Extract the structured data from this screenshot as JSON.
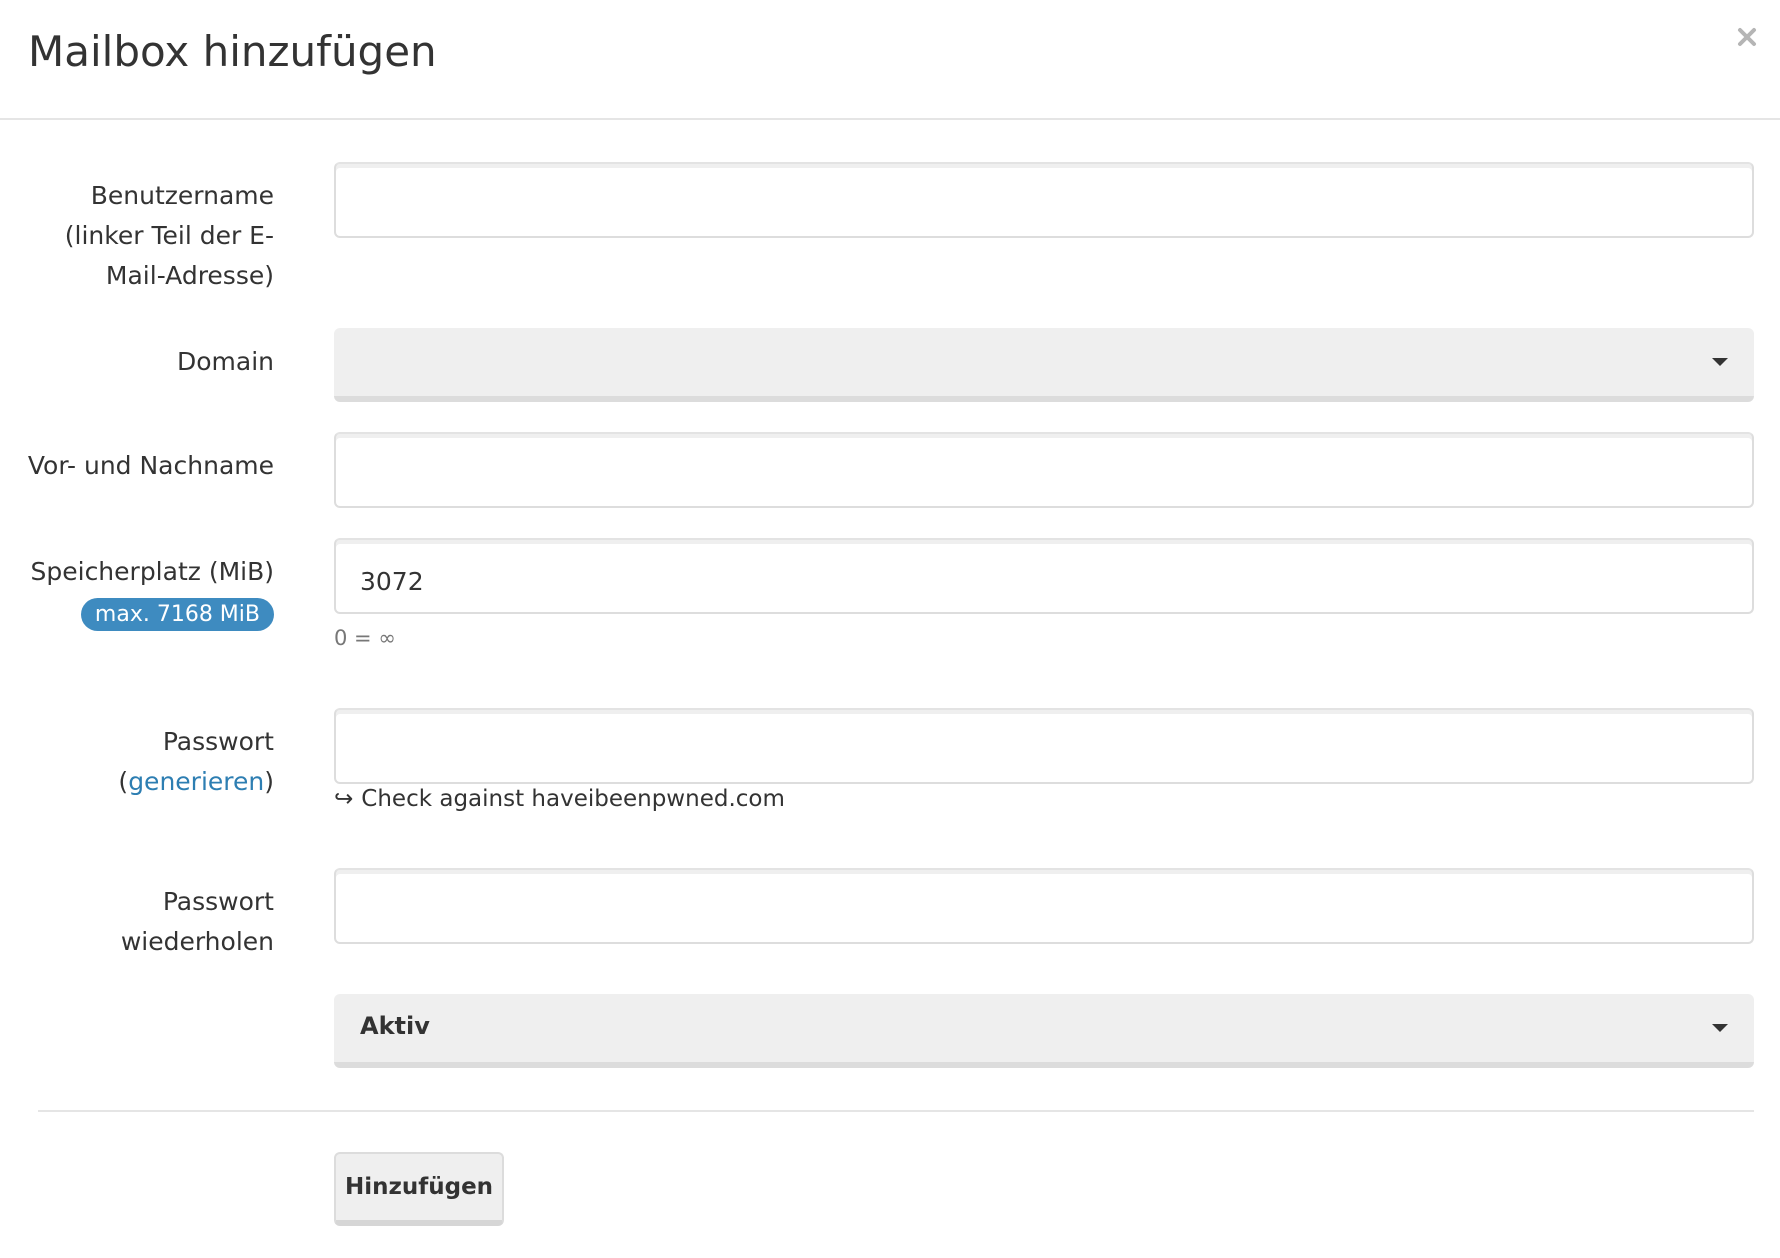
{
  "modal": {
    "title": "Mailbox hinzufügen"
  },
  "form": {
    "username": {
      "label": "Benutzername (linker Teil der E-Mail-Adresse)",
      "label_line1": "Benutzername",
      "label_line2": "(linker Teil der E-",
      "label_line3": "Mail-Adresse)",
      "value": ""
    },
    "domain": {
      "label": "Domain",
      "selected": ""
    },
    "fullname": {
      "label": "Vor- und Nachname",
      "value": ""
    },
    "quota": {
      "label": "Speicherplatz (MiB)",
      "badge": "max. 7168 MiB",
      "value": "3072",
      "help": "0 = ∞"
    },
    "password": {
      "label_line1": "Passwort",
      "generate_open": "(",
      "generate_link": "generieren",
      "generate_close": ")",
      "value": "",
      "pwned_check": "Check against haveibeenpwned.com"
    },
    "password_repeat": {
      "label_line1": "Passwort",
      "label_line2": "wiederholen",
      "value": ""
    },
    "active": {
      "selected": "Aktiv"
    },
    "submit_label": "Hinzufügen"
  },
  "icons": {
    "close": "close-icon",
    "caret": "caret-down-icon",
    "pwned_arrow": "arrow-return-icon"
  },
  "colors": {
    "link": "#2d7eb2",
    "badge": "#3e8bc0"
  }
}
